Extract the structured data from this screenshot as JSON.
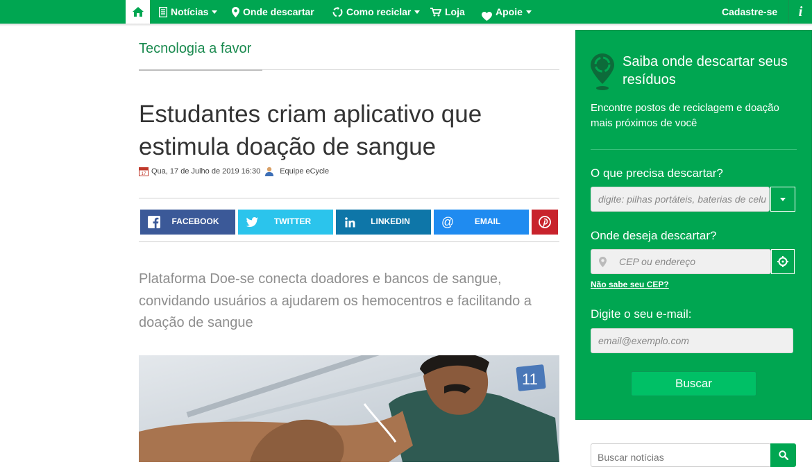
{
  "nav": {
    "items": [
      {
        "label": "Notícias",
        "icon": "newspaper-icon",
        "dropdown": true
      },
      {
        "label": "Onde descartar",
        "icon": "map-pin-icon",
        "dropdown": false
      },
      {
        "label": "Como reciclar",
        "icon": "recycle-icon",
        "dropdown": true
      },
      {
        "label": "Loja",
        "icon": "cart-icon",
        "dropdown": false
      },
      {
        "label": "Apoie",
        "icon": "heart-icon",
        "dropdown": true
      }
    ],
    "signup_label": "Cadastre-se",
    "info_label": "i"
  },
  "article": {
    "section": "Tecnologia a favor",
    "headline": "Estudantes criam aplicativo que estimula doação de sangue",
    "date": "Qua, 17 de Julho de 2019 16:30",
    "author": "Equipe eCycle",
    "lead": "Plataforma Doe-se conecta doadores e bancos de sangue, convidando usuários a ajudarem os hemocentros e facilitando a doação de sangue"
  },
  "share": [
    {
      "label": "FACEBOOK",
      "icon": "facebook-icon",
      "color": "#3b5998"
    },
    {
      "label": "TWITTER",
      "icon": "twitter-icon",
      "color": "#2bc4ec"
    },
    {
      "label": "LINKEDIN",
      "icon": "linkedin-icon",
      "color": "#0e76a8"
    },
    {
      "label": "EMAIL",
      "icon": "at-icon",
      "color": "#1f8bf0"
    },
    {
      "label": "",
      "icon": "pinterest-icon",
      "color": "#c8232c"
    }
  ],
  "sidebar": {
    "title": "Saiba onde descartar seus resíduos",
    "subtitle": "Encontre postos de reciclagem e doação mais próximos de você",
    "q1_label": "O que precisa descartar?",
    "q1_placeholder": "digite: pilhas portáteis, baterias de celu",
    "q2_label": "Onde deseja descartar?",
    "q2_placeholder": "CEP ou endereço",
    "cep_link": "Não sabe seu CEP?",
    "q3_label": "Digite o seu e-mail:",
    "q3_placeholder": "email@exemplo.com",
    "search_button": "Buscar"
  },
  "news_search": {
    "placeholder": "Buscar notícias"
  },
  "colors": {
    "brand_green": "#00a651",
    "button_green": "#00c066",
    "section_green": "#1a8a4f"
  }
}
